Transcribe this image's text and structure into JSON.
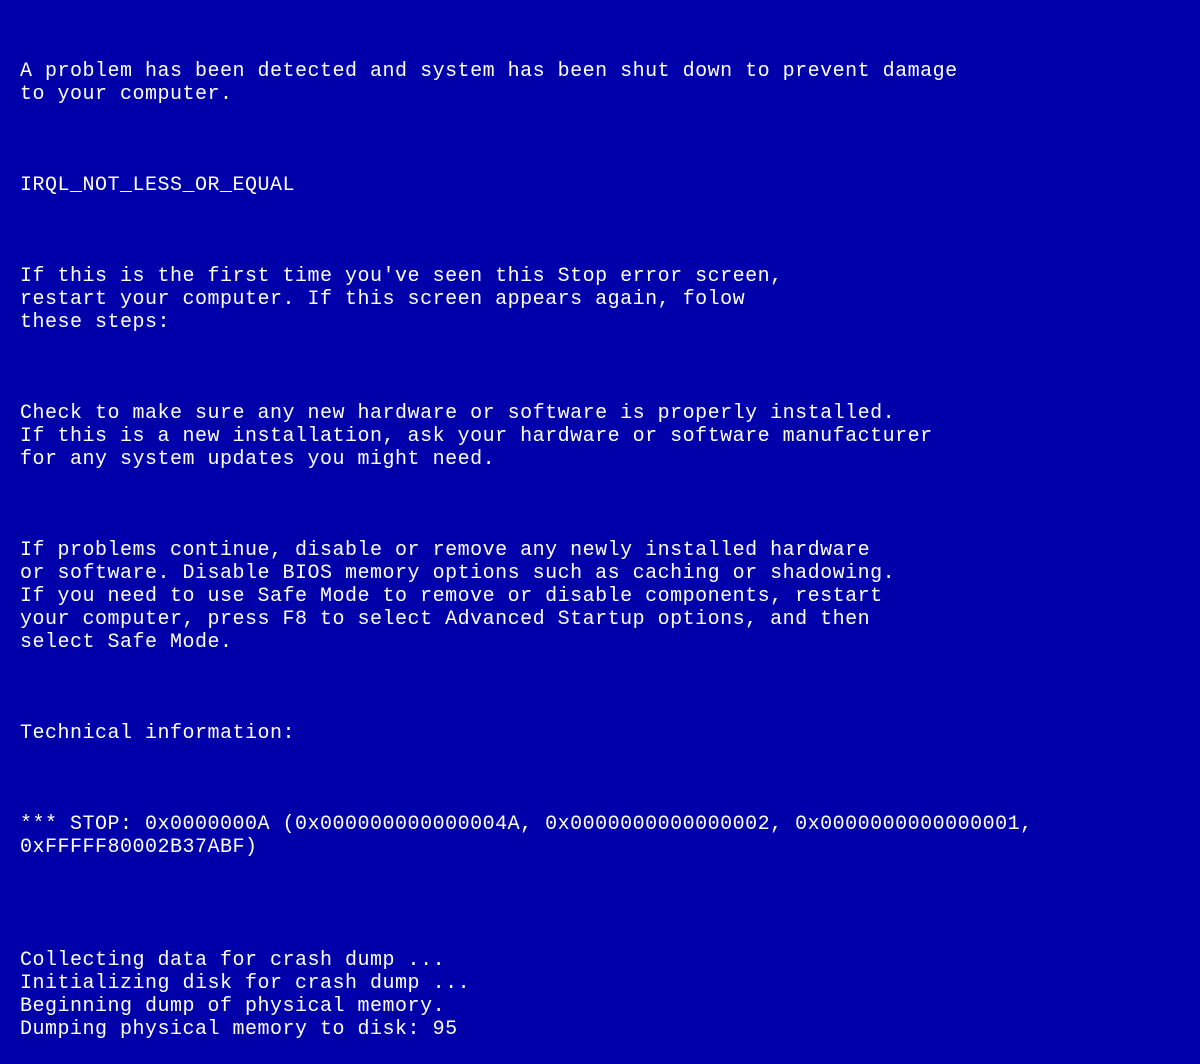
{
  "bsod": {
    "header": "A problem has been detected and system has been shut down to prevent damage\nto your computer.",
    "error_code": "IRQL_NOT_LESS_OR_EQUAL",
    "first_time": "If this is the first time you've seen this Stop error screen,\nrestart your computer. If this screen appears again, folow\nthese steps:",
    "check_hw": "Check to make sure any new hardware or software is properly installed.\nIf this is a new installation, ask your hardware or software manufacturer\nfor any system updates you might need.",
    "problems_continue": "If problems continue, disable or remove any newly installed hardware\nor software. Disable BIOS memory options such as caching or shadowing.\nIf you need to use Safe Mode to remove or disable components, restart\nyour computer, press F8 to select Advanced Startup options, and then\nselect Safe Mode.",
    "tech_info_label": "Technical information:",
    "stop_line": "*** STOP: 0x0000000A (0x000000000000004A, 0x0000000000000002, 0x0000000000000001,\n0xFFFFF80002B37ABF)",
    "dump_status": "Collecting data for crash dump ...\nInitializing disk for crash dump ...\nBeginning dump of physical memory.\nDumping physical memory to disk: 95"
  }
}
